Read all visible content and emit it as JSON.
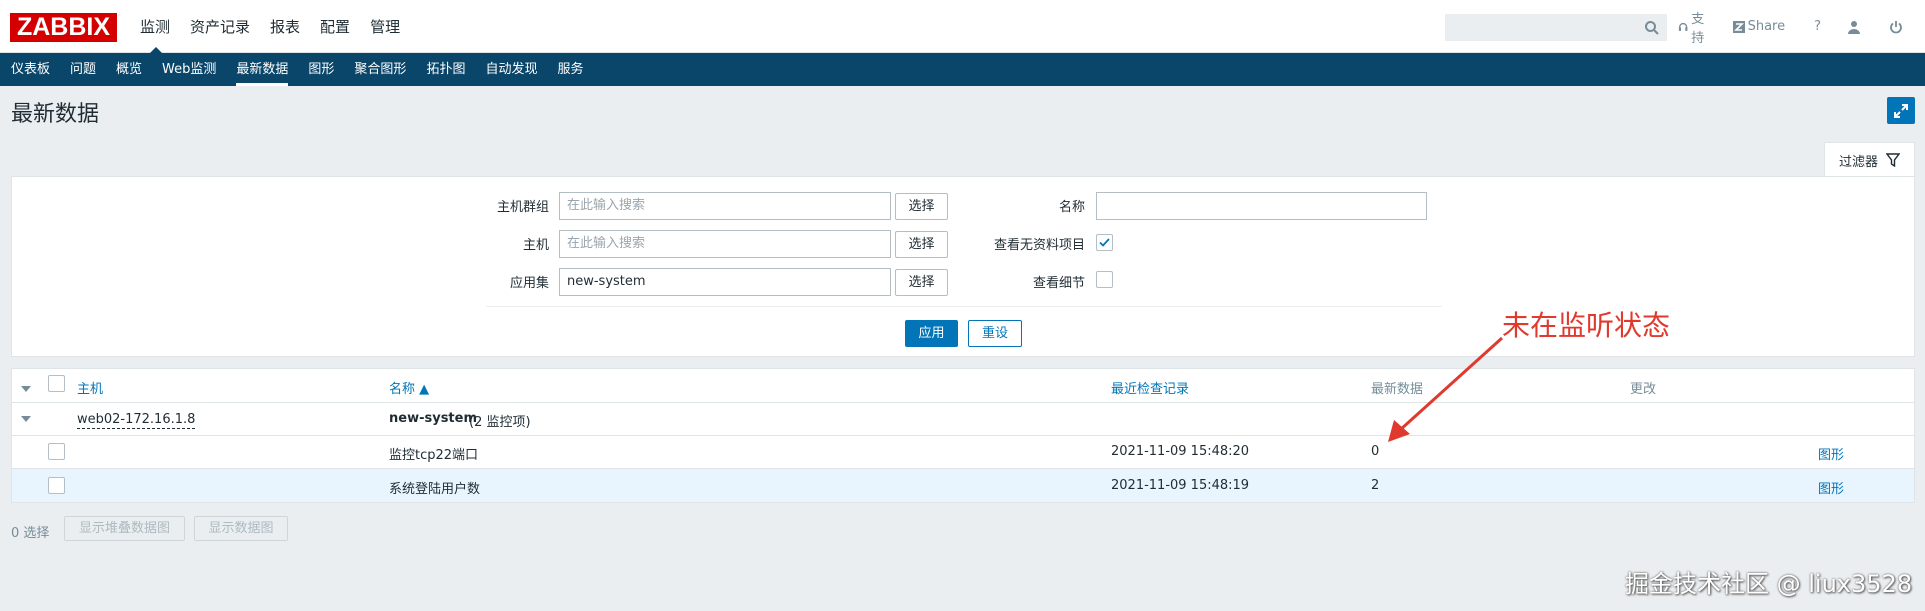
{
  "header": {
    "logo": "ZABBIX",
    "menu": [
      "监测",
      "资产记录",
      "报表",
      "配置",
      "管理"
    ],
    "search_placeholder": "",
    "support": "支持",
    "share": "Share",
    "help": "?"
  },
  "submenu": [
    "仪表板",
    "问题",
    "概览",
    "Web监测",
    "最新数据",
    "图形",
    "聚合图形",
    "拓扑图",
    "自动发现",
    "服务"
  ],
  "page": {
    "title": "最新数据"
  },
  "filter": {
    "tab_label": "过滤器",
    "host_group_label": "主机群组",
    "host_group_placeholder": "在此输入搜索",
    "host_label": "主机",
    "host_placeholder": "在此输入搜索",
    "app_label": "应用集",
    "app_value": "new-system",
    "select_label": "选择",
    "name_label": "名称",
    "name_value": "",
    "show_without_data_label": "查看无资料项目",
    "show_without_data": true,
    "show_details_label": "查看细节",
    "show_details": false,
    "apply": "应用",
    "reset": "重设"
  },
  "table": {
    "columns": [
      "主机",
      "名称 ▲",
      "最近检查记录",
      "最新数据",
      "更改"
    ],
    "host": "web02-172.16.1.8",
    "group": "new-system",
    "group_count": "(2 监控项)",
    "rows": [
      {
        "name": "监控tcp22端口",
        "last_check": "2021-11-09 15:48:20",
        "last_value": "0",
        "graph": "图形"
      },
      {
        "name": "系统登陆用户数",
        "last_check": "2021-11-09 15:48:19",
        "last_value": "2",
        "graph": "图形"
      }
    ]
  },
  "footer": {
    "selected": "0 选择",
    "btn_stacked": "显示堆叠数据图",
    "btn_graph": "显示数据图"
  },
  "annotation": "未在监听状态",
  "watermark": "掘金技术社区 @ liux3528",
  "colors": {
    "brand": "#d40000",
    "nav": "#0a466a",
    "accent": "#0275b8",
    "annotation": "#e03a2f"
  }
}
